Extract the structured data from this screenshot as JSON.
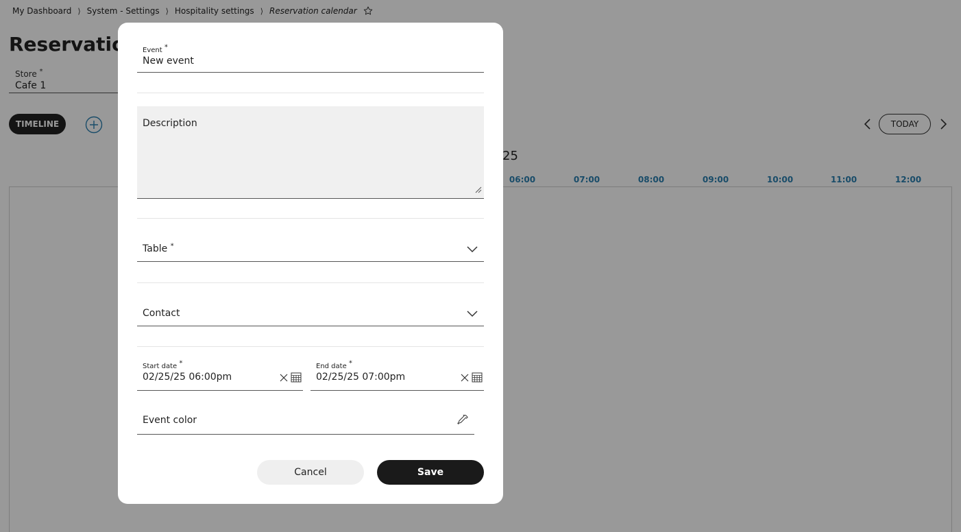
{
  "breadcrumb": {
    "items": [
      "My Dashboard",
      "System - Settings",
      "Hospitality settings"
    ],
    "current": "Reservation calendar",
    "separator": "⟩"
  },
  "page": {
    "title": "Reservation",
    "store_label": "Store",
    "store_value": "Cafe 1",
    "required_mark": "*"
  },
  "toolbar": {
    "timeline_label": "TIMELINE",
    "today_label": "TODAY"
  },
  "calendar": {
    "date_heading_fragment": "25",
    "hours": [
      "06:00",
      "07:00",
      "08:00",
      "09:00",
      "10:00",
      "11:00",
      "12:00"
    ],
    "hour_color": "#2a7fb0"
  },
  "modal": {
    "event_label": "Event",
    "event_value": "New event",
    "description_label": "Description",
    "table_label": "Table",
    "contact_label": "Contact",
    "start_date_label": "Start date",
    "start_date_value": "02/25/25 06:00pm",
    "end_date_label": "End date",
    "end_date_value": "02/25/25 07:00pm",
    "event_color_label": "Event color",
    "cancel_label": "Cancel",
    "save_label": "Save",
    "required_mark": "*"
  },
  "icons": {
    "star": "star-icon",
    "add": "add-circle-icon",
    "prev": "chevron-left-icon",
    "next": "chevron-right-icon",
    "dropdown": "chevron-down-icon",
    "clear": "close-icon",
    "calendar": "calendar-icon",
    "color_picker": "eyedropper-icon"
  }
}
